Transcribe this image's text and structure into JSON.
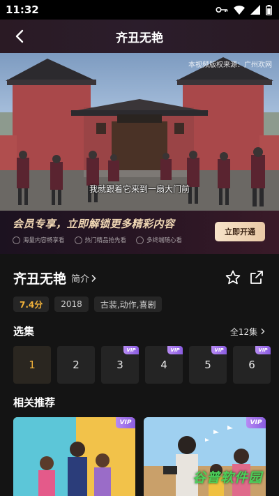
{
  "status_bar": {
    "time": "11:32"
  },
  "nav": {
    "title": "齐丑无艳"
  },
  "video": {
    "badge": "本视频版权来源：广州欢网",
    "subtitle": "我就跟着它来到一扇大门前"
  },
  "vip_banner": {
    "headline": "会员专享，立即解锁更多精彩内容",
    "perks": [
      "海量内容畅享看",
      "热门精品抢先看",
      "多终端随心看"
    ],
    "button": "立即开通"
  },
  "show": {
    "title": "齐丑无艳",
    "intro_label": "简介",
    "tags": [
      "7.4分",
      "2018",
      "古装,动作,喜剧"
    ]
  },
  "episodes": {
    "title": "选集",
    "all_label": "全12集",
    "items": [
      {
        "label": "1",
        "vip": false
      },
      {
        "label": "2",
        "vip": false
      },
      {
        "label": "3",
        "vip": true
      },
      {
        "label": "4",
        "vip": true
      },
      {
        "label": "5",
        "vip": true
      },
      {
        "label": "6",
        "vip": true
      }
    ],
    "vip_badge": "VIP"
  },
  "recommendations": {
    "title": "相关推荐",
    "vip_badge": "VIP"
  },
  "watermark": "谷普软件园",
  "colors": {
    "accent": "#f3b33a",
    "vip": "#9b6cf0",
    "background": "#141414"
  }
}
